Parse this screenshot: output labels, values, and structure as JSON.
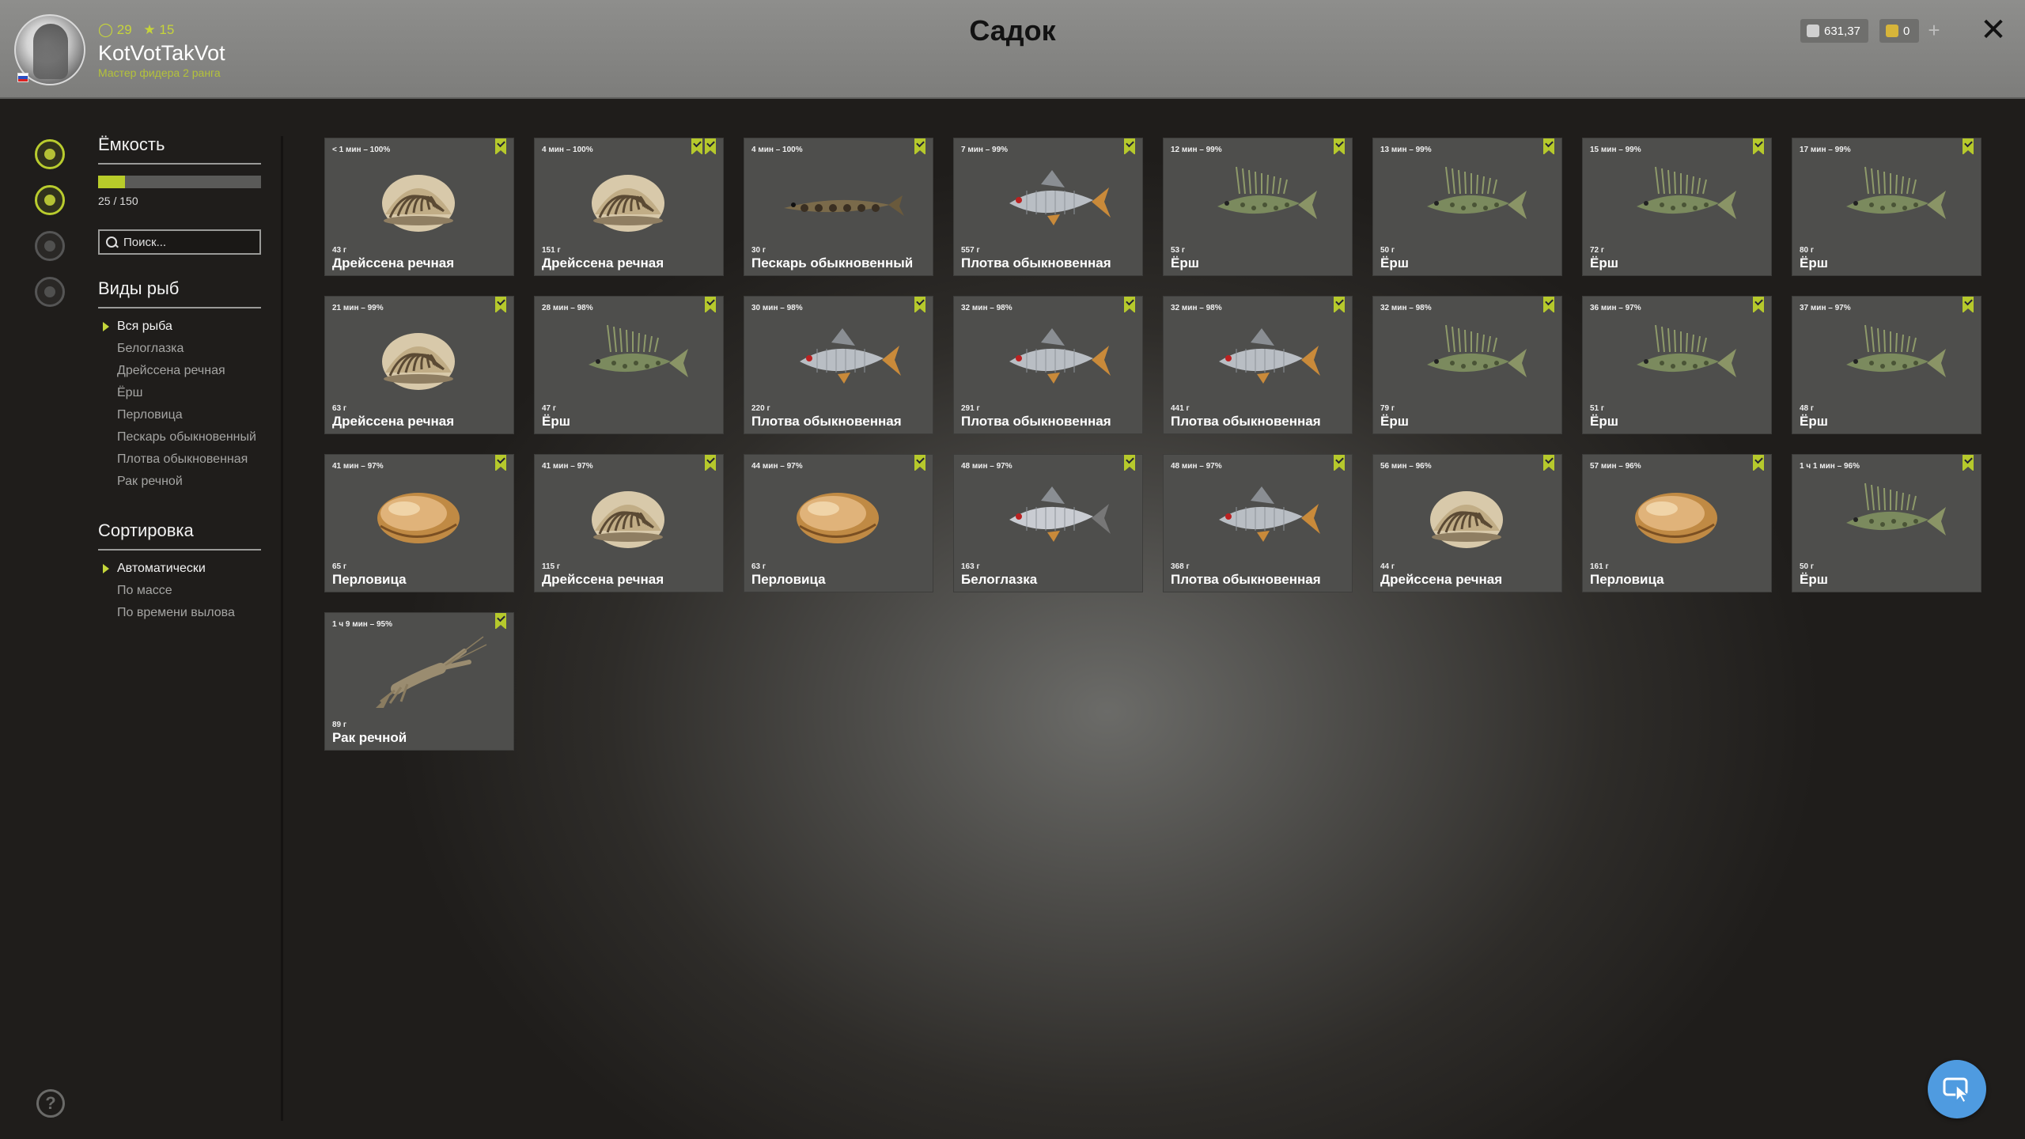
{
  "colors": {
    "accent": "#b8cc2a",
    "card_bg": "#4e4e4c",
    "header_bg": "#8e8e8c",
    "cursor_button": "#4f9be0"
  },
  "header": {
    "title": "Садок",
    "player": {
      "stat_1": "29",
      "stat_2": "15",
      "name": "KotVotTakVot",
      "rank": "Мастер фидера 2 ранга"
    },
    "silver": "631,37",
    "gold": "0"
  },
  "capacity": {
    "title": "Ёмкость",
    "value_text": "25 / 150",
    "fill": 0.1667
  },
  "search": {
    "placeholder": "Поиск..."
  },
  "species": {
    "title": "Виды рыб",
    "items": [
      {
        "label": "Вся рыба",
        "selected": true
      },
      {
        "label": "Белоглазка"
      },
      {
        "label": "Дрейссена речная"
      },
      {
        "label": "Ёрш"
      },
      {
        "label": "Перловица"
      },
      {
        "label": "Пескарь обыкновенный"
      },
      {
        "label": "Плотва обыкновенная"
      },
      {
        "label": "Рак речной"
      }
    ]
  },
  "sort": {
    "title": "Сортировка",
    "items": [
      {
        "label": "Автоматически",
        "selected": true
      },
      {
        "label": "По массе"
      },
      {
        "label": "По времени вылова"
      }
    ]
  },
  "catch": [
    {
      "time": "< 1 мин – 100%",
      "weight": "43 г",
      "name": "Дрейссена речная",
      "kind": "zebra",
      "bookmarks": 1
    },
    {
      "time": "4 мин – 100%",
      "weight": "151 г",
      "name": "Дрейссена речная",
      "kind": "zebra",
      "bookmarks": 2
    },
    {
      "time": "4 мин – 100%",
      "weight": "30 г",
      "name": "Пескарь обыкновенный",
      "kind": "gudgeon",
      "bookmarks": 1
    },
    {
      "time": "7 мин – 99%",
      "weight": "557 г",
      "name": "Плотва обыкновенная",
      "kind": "roach",
      "bookmarks": 1
    },
    {
      "time": "12 мин – 99%",
      "weight": "53 г",
      "name": "Ёрш",
      "kind": "ruffe",
      "bookmarks": 1
    },
    {
      "time": "13 мин – 99%",
      "weight": "50 г",
      "name": "Ёрш",
      "kind": "ruffe",
      "bookmarks": 1
    },
    {
      "time": "15 мин – 99%",
      "weight": "72 г",
      "name": "Ёрш",
      "kind": "ruffe",
      "bookmarks": 1
    },
    {
      "time": "17 мин – 99%",
      "weight": "80 г",
      "name": "Ёрш",
      "kind": "ruffe",
      "bookmarks": 1
    },
    {
      "time": "21 мин – 99%",
      "weight": "63 г",
      "name": "Дрейссена речная",
      "kind": "zebra",
      "bookmarks": 1
    },
    {
      "time": "28 мин – 98%",
      "weight": "47 г",
      "name": "Ёрш",
      "kind": "ruffe",
      "bookmarks": 1
    },
    {
      "time": "30 мин – 98%",
      "weight": "220 г",
      "name": "Плотва обыкновенная",
      "kind": "roach",
      "bookmarks": 1
    },
    {
      "time": "32 мин – 98%",
      "weight": "291 г",
      "name": "Плотва обыкновенная",
      "kind": "roach",
      "bookmarks": 1
    },
    {
      "time": "32 мин – 98%",
      "weight": "441 г",
      "name": "Плотва обыкновенная",
      "kind": "roach",
      "bookmarks": 1
    },
    {
      "time": "32 мин – 98%",
      "weight": "79 г",
      "name": "Ёрш",
      "kind": "ruffe",
      "bookmarks": 1
    },
    {
      "time": "36 мин – 97%",
      "weight": "51 г",
      "name": "Ёрш",
      "kind": "ruffe",
      "bookmarks": 1
    },
    {
      "time": "37 мин – 97%",
      "weight": "48 г",
      "name": "Ёрш",
      "kind": "ruffe",
      "bookmarks": 1
    },
    {
      "time": "41 мин – 97%",
      "weight": "65 г",
      "name": "Перловица",
      "kind": "pearl",
      "bookmarks": 1
    },
    {
      "time": "41 мин – 97%",
      "weight": "115 г",
      "name": "Дрейссена речная",
      "kind": "zebra",
      "bookmarks": 1
    },
    {
      "time": "44 мин – 97%",
      "weight": "63 г",
      "name": "Перловица",
      "kind": "pearl",
      "bookmarks": 1
    },
    {
      "time": "48 мин – 97%",
      "weight": "163 г",
      "name": "Белоглазка",
      "kind": "bream",
      "bookmarks": 1
    },
    {
      "time": "48 мин – 97%",
      "weight": "368 г",
      "name": "Плотва обыкновенная",
      "kind": "roach",
      "bookmarks": 1
    },
    {
      "time": "56 мин – 96%",
      "weight": "44 г",
      "name": "Дрейссена речная",
      "kind": "zebra",
      "bookmarks": 1
    },
    {
      "time": "57 мин – 96%",
      "weight": "161 г",
      "name": "Перловица",
      "kind": "pearl",
      "bookmarks": 1
    },
    {
      "time": "1 ч 1 мин – 96%",
      "weight": "50 г",
      "name": "Ёрш",
      "kind": "ruffe",
      "bookmarks": 1
    },
    {
      "time": "1 ч 9 мин – 95%",
      "weight": "89 г",
      "name": "Рак речной",
      "kind": "crayfish",
      "bookmarks": 1
    }
  ]
}
